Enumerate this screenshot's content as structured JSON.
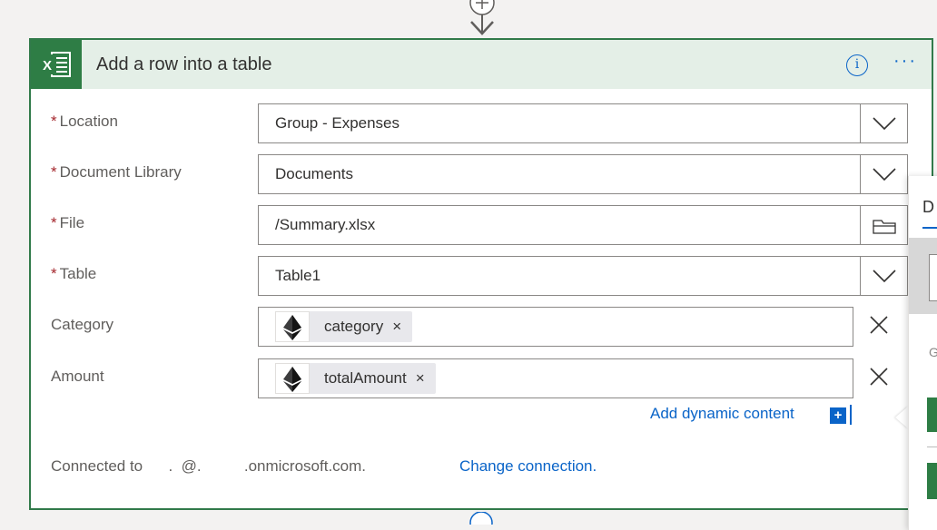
{
  "card": {
    "title": "Add a row into a table",
    "accent": "#317a4a",
    "header_bg": "#e4efe7"
  },
  "fields": {
    "location": {
      "required_mark": "*",
      "label": "Location",
      "value": "Group - Expenses"
    },
    "document_library": {
      "required_mark": "*",
      "label": "Document Library",
      "value": "Documents"
    },
    "file": {
      "required_mark": "*",
      "label": "File",
      "value": "/Summary.xlsx"
    },
    "table": {
      "required_mark": "*",
      "label": "Table",
      "value": "Table1"
    },
    "category": {
      "label": "Category",
      "token": "category",
      "token_remove": "×"
    },
    "amount": {
      "label": "Amount",
      "token": "totalAmount",
      "token_remove": "×"
    }
  },
  "dynamic_content": {
    "label": "Add dynamic content",
    "plus": "+"
  },
  "connection": {
    "prefix": "Connected to  ",
    "account": "    .  @.          .onmicrosoft.com.",
    "change_label": "Change connection."
  },
  "side_panel": {
    "tab_label": "D",
    "icon": "G"
  },
  "icons": {
    "header": [
      "excel-icon",
      "info-icon",
      "more-icon"
    ],
    "fields": [
      "chevron-down-icon",
      "folder-icon",
      "ethereum-icon",
      "close-icon"
    ]
  },
  "colors": {
    "link": "#0a64c8",
    "required": "#a4262c",
    "excel_green": "#2e7d45"
  }
}
